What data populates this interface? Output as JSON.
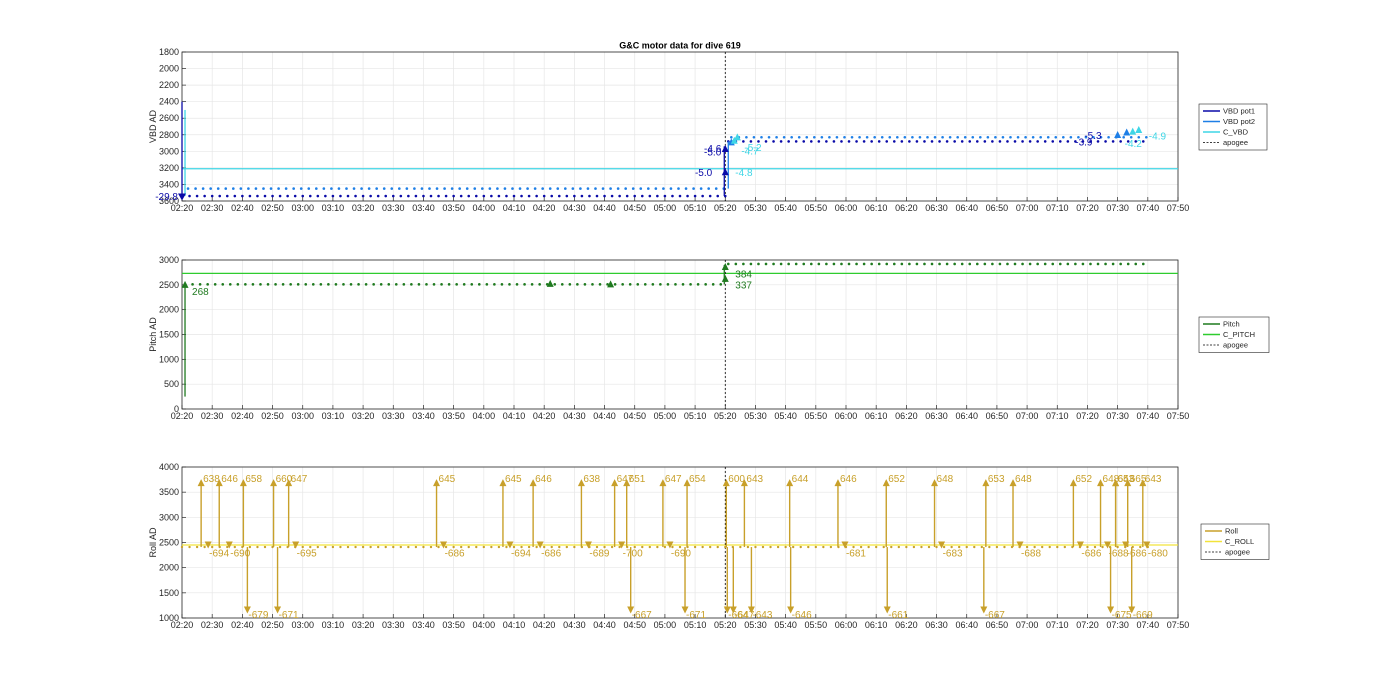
{
  "figure_title": "G&C motor data for dive 619",
  "colors": {
    "vbd_pot1": "#0a0aa8",
    "vbd_pot2": "#1e7fe6",
    "c_vbd": "#3fd6e6",
    "pitch": "#1f7a1f",
    "c_pitch": "#2ecc2e",
    "roll": "#c8a02a",
    "c_roll": "#f2e33a",
    "apogee": "#000000",
    "grid": "#e6e6e6",
    "axes": "#262626"
  },
  "x_ticks": [
    "02:20",
    "02:30",
    "02:40",
    "02:50",
    "03:00",
    "03:10",
    "03:20",
    "03:30",
    "03:40",
    "03:50",
    "04:00",
    "04:10",
    "04:20",
    "04:30",
    "04:40",
    "04:50",
    "05:00",
    "05:10",
    "05:20",
    "05:30",
    "05:40",
    "05:50",
    "06:00",
    "06:10",
    "06:20",
    "06:30",
    "06:40",
    "06:50",
    "07:00",
    "07:10",
    "07:20",
    "07:30",
    "07:40",
    "07:50"
  ],
  "chart_data": [
    {
      "type": "scatter",
      "ylabel": "VBD AD",
      "ylim": [
        1800,
        3600
      ],
      "y_reversed": true,
      "yticks": [
        1800,
        2000,
        2200,
        2400,
        2600,
        2800,
        3000,
        3200,
        3400,
        3600
      ],
      "xlim": [
        "02:20",
        "07:50"
      ],
      "apogee": "05:20",
      "legend": [
        "VBD pot1",
        "VBD pot2",
        "C_VBD",
        "apogee"
      ],
      "series": [
        {
          "name": "VBD pot1",
          "color_key": "vbd_pot1",
          "segments": [
            {
              "x0": "02:20",
              "x1": "05:20",
              "y": 3540
            },
            {
              "x0": "05:21",
              "x1": "07:40",
              "y": 2880
            }
          ]
        },
        {
          "name": "VBD pot2",
          "color_key": "vbd_pot2",
          "segments": [
            {
              "x0": "02:22",
              "x1": "05:20",
              "y": 3450
            },
            {
              "x0": "05:22",
              "x1": "07:40",
              "y": 2830
            }
          ]
        },
        {
          "name": "C_VBD",
          "color_key": "c_vbd",
          "constant": 3210
        }
      ],
      "annotations": [
        {
          "text": "-29.8",
          "x": "02:20",
          "y": 3540,
          "color_key": "vbd_pot1",
          "side": "left"
        },
        {
          "text": "-5.0",
          "x": "05:20",
          "y": 3000,
          "color_key": "vbd_pot1",
          "side": "left"
        },
        {
          "text": "-4.6",
          "x": "05:20",
          "y": 2960,
          "color_key": "vbd_pot1",
          "side": "left"
        },
        {
          "text": "-5.0",
          "x": "05:17",
          "y": 3250,
          "color_key": "vbd_pot1",
          "side": "left"
        },
        {
          "text": "-4.7",
          "x": "05:24",
          "y": 2990,
          "color_key": "c_vbd",
          "side": "right"
        },
        {
          "text": "-5.2",
          "x": "05:25",
          "y": 2950,
          "color_key": "c_vbd",
          "side": "right"
        },
        {
          "text": "-4.8",
          "x": "05:22",
          "y": 3250,
          "color_key": "c_vbd",
          "side": "right"
        },
        {
          "text": "-3.9",
          "x": "07:23",
          "y": 2880,
          "color_key": "vbd_pot1",
          "side": "left"
        },
        {
          "text": "-5.3",
          "x": "07:26",
          "y": 2800,
          "color_key": "vbd_pot1",
          "side": "left"
        },
        {
          "text": "-4.2",
          "x": "07:31",
          "y": 2900,
          "color_key": "c_vbd",
          "side": "right"
        },
        {
          "text": "-4.9",
          "x": "07:39",
          "y": 2810,
          "color_key": "c_vbd",
          "side": "right"
        }
      ]
    },
    {
      "type": "scatter",
      "ylabel": "Pitch AD",
      "ylim": [
        0,
        3000
      ],
      "yticks": [
        0,
        500,
        1000,
        1500,
        2000,
        2500,
        3000
      ],
      "xlim": [
        "02:20",
        "07:50"
      ],
      "apogee": "05:20",
      "legend": [
        "Pitch",
        "C_PITCH",
        "apogee"
      ],
      "series": [
        {
          "name": "Pitch",
          "color_key": "pitch",
          "segments": [
            {
              "x0": "02:21",
              "x1": "05:20",
              "y": 2510
            },
            {
              "x0": "05:21",
              "x1": "07:40",
              "y": 2920
            }
          ]
        },
        {
          "name": "C_PITCH",
          "color_key": "c_pitch",
          "constant": 2730
        }
      ],
      "annotations": [
        {
          "text": "268",
          "x": "02:22",
          "y": 2380,
          "color_key": "pitch",
          "side": "right"
        },
        {
          "text": "384",
          "x": "05:22",
          "y": 2730,
          "color_key": "pitch",
          "side": "right"
        },
        {
          "text": "337",
          "x": "05:22",
          "y": 2510,
          "color_key": "pitch",
          "side": "right"
        }
      ]
    },
    {
      "type": "scatter",
      "ylabel": "Roll AD",
      "ylim": [
        1000,
        4000
      ],
      "yticks": [
        1000,
        1500,
        2000,
        2500,
        3000,
        3500,
        4000
      ],
      "xlim": [
        "02:20",
        "07:50"
      ],
      "apogee": "05:20",
      "legend": [
        "Roll",
        "C_ROLL",
        "apogee"
      ],
      "series": [
        {
          "name": "Roll",
          "color_key": "roll",
          "baseline": 2410
        },
        {
          "name": "C_ROLL",
          "color_key": "c_roll",
          "constant": 2450
        }
      ],
      "up_labels": [
        {
          "x": "02:27",
          "text": "638"
        },
        {
          "x": "02:33",
          "text": "646"
        },
        {
          "x": "02:41",
          "text": "658"
        },
        {
          "x": "02:51",
          "text": "660"
        },
        {
          "x": "02:56",
          "text": "647"
        },
        {
          "x": "03:45",
          "text": "645"
        },
        {
          "x": "04:07",
          "text": "645"
        },
        {
          "x": "04:17",
          "text": "646"
        },
        {
          "x": "04:33",
          "text": "638"
        },
        {
          "x": "04:44",
          "text": "647"
        },
        {
          "x": "04:48",
          "text": "651"
        },
        {
          "x": "05:00",
          "text": "647"
        },
        {
          "x": "05:08",
          "text": "654"
        },
        {
          "x": "05:21",
          "text": "600"
        },
        {
          "x": "05:27",
          "text": "643"
        },
        {
          "x": "05:42",
          "text": "644"
        },
        {
          "x": "05:58",
          "text": "646"
        },
        {
          "x": "06:14",
          "text": "652"
        },
        {
          "x": "06:30",
          "text": "648"
        },
        {
          "x": "06:47",
          "text": "653"
        },
        {
          "x": "06:56",
          "text": "648"
        },
        {
          "x": "07:16",
          "text": "652"
        },
        {
          "x": "07:25",
          "text": "648"
        },
        {
          "x": "07:30",
          "text": "643"
        },
        {
          "x": "07:30",
          "text": "653"
        },
        {
          "x": "07:34",
          "text": "665"
        },
        {
          "x": "07:39",
          "text": "643"
        }
      ],
      "down_labels": [
        {
          "x": "02:28",
          "text": "-694"
        },
        {
          "x": "02:35",
          "text": "-690"
        },
        {
          "x": "02:41",
          "text": "-679"
        },
        {
          "x": "02:51",
          "text": "-671"
        },
        {
          "x": "02:57",
          "text": "-695"
        },
        {
          "x": "03:46",
          "text": "-686"
        },
        {
          "x": "04:08",
          "text": "-694"
        },
        {
          "x": "04:18",
          "text": "-686"
        },
        {
          "x": "04:34",
          "text": "-689"
        },
        {
          "x": "04:45",
          "text": "-700"
        },
        {
          "x": "04:48",
          "text": "-667"
        },
        {
          "x": "05:01",
          "text": "-690"
        },
        {
          "x": "05:06",
          "text": "-671"
        },
        {
          "x": "05:20",
          "text": "-664"
        },
        {
          "x": "05:22",
          "text": "-647"
        },
        {
          "x": "05:28",
          "text": "-643"
        },
        {
          "x": "05:41",
          "text": "-646"
        },
        {
          "x": "05:59",
          "text": "-681"
        },
        {
          "x": "06:13",
          "text": "-661"
        },
        {
          "x": "06:31",
          "text": "-683"
        },
        {
          "x": "06:45",
          "text": "-667"
        },
        {
          "x": "06:57",
          "text": "-688"
        },
        {
          "x": "07:17",
          "text": "-686"
        },
        {
          "x": "07:26",
          "text": "-688"
        },
        {
          "x": "07:27",
          "text": "-675"
        },
        {
          "x": "07:32",
          "text": "-686"
        },
        {
          "x": "07:34",
          "text": "-669"
        },
        {
          "x": "07:39",
          "text": "-680"
        }
      ]
    }
  ]
}
